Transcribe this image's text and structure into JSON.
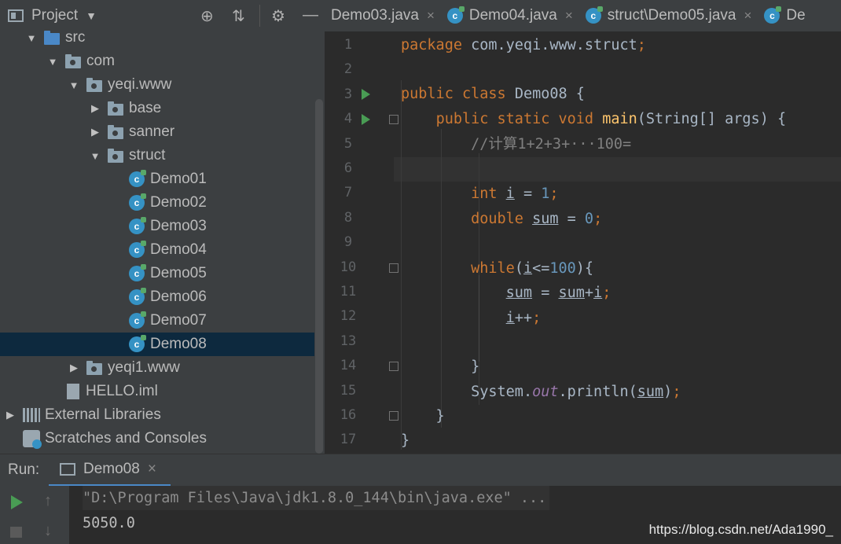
{
  "project": {
    "title": "Project"
  },
  "tree": [
    {
      "label": "src",
      "indent": 1,
      "expanded": true,
      "icon": "src-folder"
    },
    {
      "label": "com",
      "indent": 2,
      "expanded": true,
      "icon": "package"
    },
    {
      "label": "yeqi.www",
      "indent": 3,
      "expanded": true,
      "icon": "package"
    },
    {
      "label": "base",
      "indent": 4,
      "expanded": false,
      "icon": "package"
    },
    {
      "label": "sanner",
      "indent": 4,
      "expanded": false,
      "icon": "package"
    },
    {
      "label": "struct",
      "indent": 4,
      "expanded": true,
      "icon": "package"
    },
    {
      "label": "Demo01",
      "indent": 5,
      "icon": "class"
    },
    {
      "label": "Demo02",
      "indent": 5,
      "icon": "class"
    },
    {
      "label": "Demo03",
      "indent": 5,
      "icon": "class"
    },
    {
      "label": "Demo04",
      "indent": 5,
      "icon": "class"
    },
    {
      "label": "Demo05",
      "indent": 5,
      "icon": "class"
    },
    {
      "label": "Demo06",
      "indent": 5,
      "icon": "class"
    },
    {
      "label": "Demo07",
      "indent": 5,
      "icon": "class"
    },
    {
      "label": "Demo08",
      "indent": 5,
      "icon": "class",
      "selected": true
    },
    {
      "label": "yeqi1.www",
      "indent": 3,
      "expanded": false,
      "icon": "package"
    },
    {
      "label": "HELLO.iml",
      "indent": 2,
      "icon": "iml"
    },
    {
      "label": "External Libraries",
      "indent": 0,
      "expanded": false,
      "icon": "library"
    },
    {
      "label": "Scratches and Consoles",
      "indent": 0,
      "icon": "scratches"
    }
  ],
  "tabs": [
    {
      "label": "Demo03.java"
    },
    {
      "label": "Demo04.java"
    },
    {
      "label": "struct\\Demo05.java"
    },
    {
      "label": "De"
    }
  ],
  "editor": {
    "line_numbers": [
      "1",
      "2",
      "3",
      "4",
      "5",
      "6",
      "7",
      "8",
      "9",
      "10",
      "11",
      "12",
      "13",
      "14",
      "15",
      "16",
      "17"
    ],
    "line_comment": "//计算1+2+3+···100=",
    "package_kw": "package",
    "package_name": "com.yeqi.www.struct",
    "public_kw": "public",
    "class_kw": "class",
    "class_name": "Demo08",
    "static_kw": "static",
    "void_kw": "void",
    "main_name": "main",
    "main_params": "(String[] args)",
    "int_kw": "int",
    "double_kw": "double",
    "while_kw": "while",
    "var_i": "i",
    "var_sum": "sum",
    "num_1": "1",
    "num_0": "0",
    "num_100": "100",
    "system": "System",
    "out": "out",
    "println": "println"
  },
  "run": {
    "label": "Run:",
    "tab": "Demo08",
    "cmd": "\"D:\\Program Files\\Java\\jdk1.8.0_144\\bin\\java.exe\" ...",
    "output": "5050.0"
  },
  "watermark": "https://blog.csdn.net/Ada1990_"
}
